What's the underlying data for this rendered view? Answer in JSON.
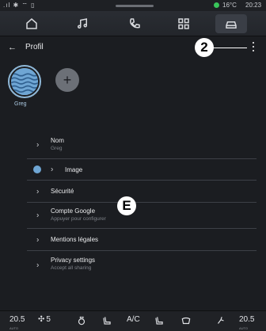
{
  "status_bar": {
    "temperature": "16°C",
    "time": "20:23"
  },
  "nav": {
    "items": [
      {
        "name": "home",
        "icon": "home-icon"
      },
      {
        "name": "music",
        "icon": "music-note-icon"
      },
      {
        "name": "phone",
        "icon": "phone-icon"
      },
      {
        "name": "apps",
        "icon": "apps-grid-icon"
      },
      {
        "name": "vehicle",
        "icon": "car-icon",
        "active": true
      }
    ]
  },
  "header": {
    "title": "Profil",
    "back_icon": "back-arrow-icon",
    "menu_icon": "kebab-menu-icon"
  },
  "callouts": {
    "menu": "2",
    "list": "E"
  },
  "profiles": {
    "current_name": "Greg",
    "add_label": "+"
  },
  "list": [
    {
      "key": "name",
      "label": "Nom",
      "sub": "Greg"
    },
    {
      "key": "image",
      "label": "Image",
      "sub": ""
    },
    {
      "key": "security",
      "label": "Sécurité",
      "sub": ""
    },
    {
      "key": "google",
      "label": "Compte Google",
      "sub": "Appuyer pour configurer"
    },
    {
      "key": "legal",
      "label": "Mentions légales",
      "sub": ""
    },
    {
      "key": "privacy",
      "label": "Privacy settings",
      "sub": "Accept all sharing"
    }
  ],
  "bottom_bar": {
    "left_temp": "20.5",
    "left_temp_label": "AUTO",
    "fan_speed": "5",
    "ac_label": "A/C",
    "right_temp": "20.5",
    "right_temp_label": "AUTO"
  }
}
